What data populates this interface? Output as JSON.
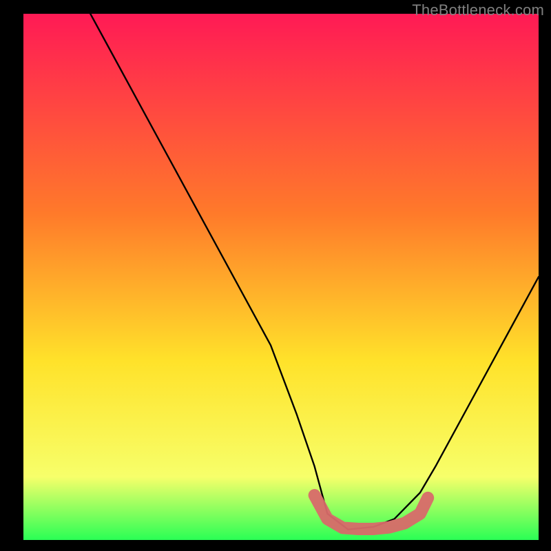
{
  "watermark": "TheBottleneck.com",
  "colors": {
    "gradient_top": "#ff1a55",
    "gradient_mid1": "#ff7a2a",
    "gradient_mid2": "#ffe22a",
    "gradient_mid3": "#f7ff6a",
    "gradient_bottom": "#2aff55",
    "curve": "#000000",
    "marker": "#d86a6a",
    "frame": "#000000"
  },
  "chart_data": {
    "type": "line",
    "title": "",
    "xlabel": "",
    "ylabel": "",
    "xlim": [
      0,
      100
    ],
    "ylim": [
      0,
      100
    ],
    "series": [
      {
        "name": "bottleneck-curve",
        "x": [
          13,
          18,
          23,
          28,
          33,
          38,
          43,
          48,
          53,
          56.5,
          59,
          63,
          68,
          72,
          77,
          80,
          85,
          90,
          95,
          100
        ],
        "values": [
          100,
          91,
          82,
          73,
          64,
          55,
          46,
          37,
          24,
          14,
          5,
          2,
          2.5,
          4,
          9,
          14,
          23,
          32,
          41,
          50
        ]
      }
    ],
    "markers": {
      "name": "bottom-highlight",
      "kind": "thick-rounded-segment",
      "x": [
        56.5,
        59,
        62,
        65,
        68,
        71,
        74,
        77,
        78.5
      ],
      "values": [
        8.5,
        4,
        2.3,
        2.1,
        2.1,
        2.4,
        3.2,
        5,
        8
      ]
    }
  }
}
